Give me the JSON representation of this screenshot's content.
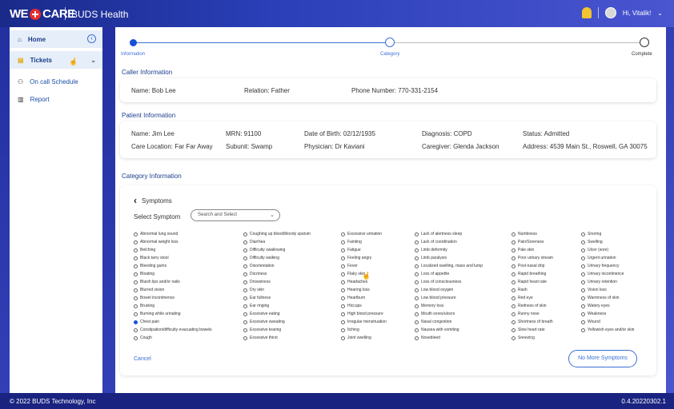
{
  "header": {
    "logo_left": "WE",
    "logo_right": "CARE",
    "app_name": "BUDS Health",
    "user_greeting": "Hi, Vitalik!"
  },
  "sidebar": {
    "items": [
      {
        "label": "Home",
        "icon": "home-icon"
      },
      {
        "label": "Tickets",
        "icon": "ticket-icon"
      },
      {
        "label": "On call Schedule",
        "icon": "schedule-icon"
      },
      {
        "label": "Report",
        "icon": "report-icon"
      }
    ]
  },
  "stepper": {
    "steps": [
      {
        "label": "Information",
        "state": "done"
      },
      {
        "label": "Category",
        "state": "active"
      },
      {
        "label": "Complete",
        "state": "pending"
      }
    ]
  },
  "caller": {
    "section_title": "Caller Information",
    "name": "Name: Bob Lee",
    "relation": "Relation: Father",
    "phone": "Phone Number: 770-331-2154"
  },
  "patient": {
    "section_title": "Patient Information",
    "name": "Name: Jim Lee",
    "mrn": "MRN: 91100",
    "dob": "Date of Birth: 02/12/1935",
    "diagnosis": "Diagnosis: COPD",
    "status": "Status: Admitted",
    "care_location": "Care Location: Far Far Away",
    "subunit": "Subunit: Swamp",
    "physician": "Physician: Dr Kaviani",
    "caregiver": "Caregiver: Glenda Jackson",
    "address": "Address: 4539 Main St., Roswell, GA 30075"
  },
  "category": {
    "section_title": "Category Information",
    "header": "Symptoms",
    "select_label": "Select Symptom",
    "select_placeholder": "Search and Select",
    "cancel_label": "Cancel",
    "no_more_label": "No More Symptoms",
    "checked_symptom": "Chest pain",
    "columns": [
      [
        "Abnormal lung sound",
        "Abnormal weight loss",
        "Belching",
        "Black tarry stool",
        "Bleeding gums",
        "Bloating",
        "Bluish lips and/or nails",
        "Blurred vision",
        "Bowel incontinence",
        "Bruising",
        "Burning while urinating",
        "Chest pain",
        "Constipation/difficulty evacuating bowels",
        "Cough"
      ],
      [
        "Coughing up blood/bloody sputum",
        "Diarrhea",
        "Difficulty swallowing",
        "Difficulty walking",
        "Disorientation",
        "Dizziness",
        "Drowsiness",
        "Dry skin",
        "Ear fullness",
        "Ear ringing",
        "Excessive eating",
        "Excessive sweating",
        "Excessive tearing",
        "Excessive thirst"
      ],
      [
        "Excessive urination",
        "Fainting",
        "Fatigue",
        "Feeling angry",
        "Fever",
        "Flaky skin",
        "Headaches",
        "Hearing loss",
        "Heartburn",
        "Hiccups",
        "High blood pressure",
        "Irregular menstruation",
        "Itching",
        "Joint swelling"
      ],
      [
        "Lack of alertness sleep",
        "Lack of coordination",
        "Limb deformity",
        "Limb paralysis",
        "Localized swelling, mass and lump",
        "Loss of appetite",
        "Loss of consciousness",
        "Low blood oxygen",
        "Low blood pressure",
        "Memory loss",
        "Mouth sores/ulcers",
        "Nasal congestion",
        "Nausea with vomiting",
        "Nosebleed"
      ],
      [
        "Numbness",
        "Pain/Soreness",
        "Pale skin",
        "Poor urinary stream",
        "Post-nasal drip",
        "Rapid breathing",
        "Rapid heart rate",
        "Rash",
        "Red eye",
        "Redness of skin",
        "Runny nose",
        "Shortness of breath",
        "Slow heart rate",
        "Sneezing"
      ],
      [
        "Snoring",
        "Swelling",
        "Ulcer (sore)",
        "Urgent urination",
        "Urinary frequency",
        "Urinary incontinence",
        "Urinary retention",
        "Vision loss",
        "Warmness of skin",
        "Watery eyes",
        "Weakness",
        "Wound",
        "Yellowish eyes and/or skin"
      ]
    ]
  },
  "footer": {
    "copyright": "© 2022 BUDS Technology, Inc",
    "version": "0.4.20220302.1"
  }
}
